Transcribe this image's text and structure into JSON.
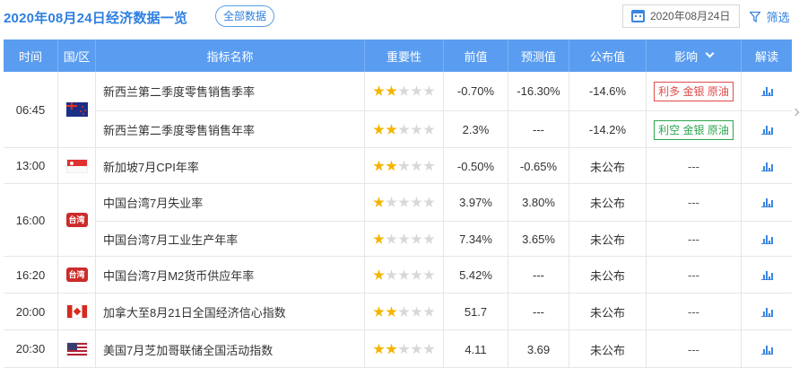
{
  "header": {
    "title": "2020年08月24日经济数据一览",
    "all_data_label": "全部数据",
    "date_value": "2020年08月24日",
    "filter_label": "筛选"
  },
  "columns": [
    "时间",
    "国/区",
    "指标名称",
    "重要性",
    "前值",
    "预测值",
    "公布值",
    "影响",
    "解读"
  ],
  "colors": {
    "accent": "#2e7fe0",
    "header_bg": "#5a9df0",
    "bullish": "#e04a4a",
    "bearish": "#2ea44f",
    "star_on": "#f5b400",
    "star_off": "#d8d8d8"
  },
  "groups": [
    {
      "time": "06:45",
      "flag": "nz-flag-icon",
      "flag_text": "",
      "rows": [
        {
          "name": "新西兰第二季度零售销售季率",
          "importance": 2,
          "prev": "-0.70%",
          "forecast": "-16.30%",
          "actual": "-14.6%",
          "impact": "利多 金银 原油",
          "impact_type": "bullish"
        },
        {
          "name": "新西兰第二季度零售销售年率",
          "importance": 2,
          "prev": "2.3%",
          "forecast": "---",
          "actual": "-14.2%",
          "impact": "利空 金银 原油",
          "impact_type": "bearish"
        }
      ]
    },
    {
      "time": "13:00",
      "flag": "sg-flag-icon",
      "flag_text": "",
      "rows": [
        {
          "name": "新加坡7月CPI年率",
          "importance": 2,
          "prev": "-0.50%",
          "forecast": "-0.65%",
          "actual": "未公布",
          "impact": "---",
          "impact_type": "none"
        }
      ]
    },
    {
      "time": "16:00",
      "flag": "tw-badge-icon",
      "flag_text": "台湾",
      "rows": [
        {
          "name": "中国台湾7月失业率",
          "importance": 1,
          "prev": "3.97%",
          "forecast": "3.80%",
          "actual": "未公布",
          "impact": "---",
          "impact_type": "none"
        },
        {
          "name": "中国台湾7月工业生产年率",
          "importance": 1,
          "prev": "7.34%",
          "forecast": "3.65%",
          "actual": "未公布",
          "impact": "---",
          "impact_type": "none"
        }
      ]
    },
    {
      "time": "16:20",
      "flag": "tw-badge-icon",
      "flag_text": "台湾",
      "rows": [
        {
          "name": "中国台湾7月M2货币供应年率",
          "importance": 1,
          "prev": "5.42%",
          "forecast": "---",
          "actual": "未公布",
          "impact": "---",
          "impact_type": "none"
        }
      ]
    },
    {
      "time": "20:00",
      "flag": "ca-flag-icon",
      "flag_text": "",
      "rows": [
        {
          "name": "加拿大至8月21日全国经济信心指数",
          "importance": 2,
          "prev": "51.7",
          "forecast": "---",
          "actual": "未公布",
          "impact": "---",
          "impact_type": "none"
        }
      ]
    },
    {
      "time": "20:30",
      "flag": "us-flag-icon",
      "flag_text": "",
      "rows": [
        {
          "name": "美国7月芝加哥联储全国活动指数",
          "importance": 2,
          "prev": "4.11",
          "forecast": "3.69",
          "actual": "未公布",
          "impact": "---",
          "impact_type": "none"
        }
      ]
    }
  ]
}
